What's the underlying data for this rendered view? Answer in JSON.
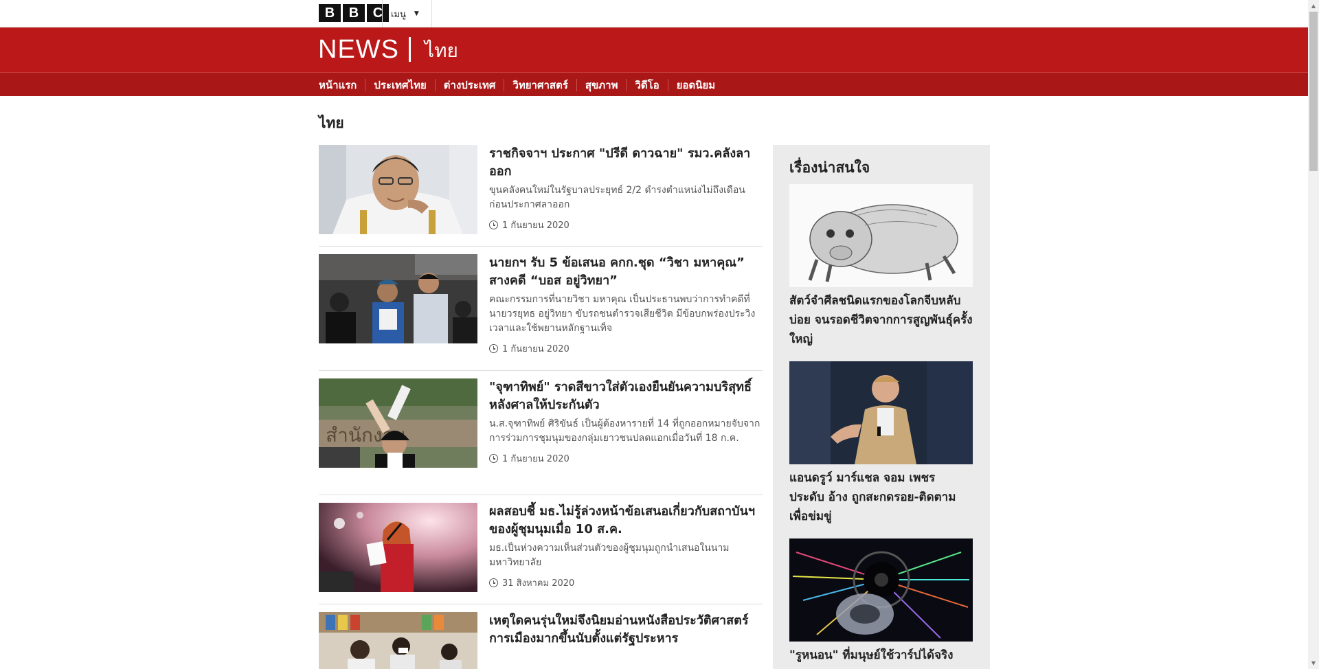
{
  "header": {
    "bbc_letters": [
      "B",
      "B",
      "C"
    ],
    "menu_label": "เมนู",
    "news_word": "NEWS",
    "language": "ไทย"
  },
  "nav": {
    "items": [
      {
        "label": "หน้าแรก"
      },
      {
        "label": "ประเทศไทย"
      },
      {
        "label": "ต่างประเทศ"
      },
      {
        "label": "วิทยาศาสตร์"
      },
      {
        "label": "สุขภาพ"
      },
      {
        "label": "วิดีโอ"
      },
      {
        "label": "ยอดนิยม"
      }
    ]
  },
  "page": {
    "title": "ไทย"
  },
  "stories": [
    {
      "headline": "ราชกิจจาฯ ประกาศ \"ปรีดี ดาวฉาย\" รมว.คลังลาออก",
      "summary": "ขุนคลังคนใหม่ในรัฐบาลประยุทธ์ 2/2 ดำรงตำแหน่งไม่ถึงเดือน ก่อนประกาศลาออก",
      "date": "1 กันยายน 2020",
      "image": "minister-portrait"
    },
    {
      "headline": "นายกฯ รับ 5 ข้อเสนอ คกก.ชุด “วิชา มหาคุณ” สางคดี “บอส อยู่วิทยา”",
      "summary": "คณะกรรมการที่นายวิชา มหาคุณ เป็นประธานพบว่าการทำคดีที่นายวรยุทธ อยู่วิทยา ขับรถชนตำรวจเสียชีวิต มีข้อบกพร่องประวิงเวลาและใช้พยานหลักฐานเท็จ",
      "date": "1 กันยายน 2020",
      "image": "press-crowd"
    },
    {
      "headline": "\"จุฑาทิพย์\" ราดสีขาวใส่ตัวเองยืนยันความบริสุทธิ์ หลังศาลให้ประกันตัว",
      "summary": "น.ส.จุฑาทิพย์ ศิริขันธ์ เป็นผู้ต้องหารายที่ 14 ที่ถูกออกหมายจับจากการร่วมการชุมนุมของกลุ่มเยาวชนปลดแอกเมื่อวันที่ 18 ก.ค.",
      "date": "1 กันยายน 2020",
      "image": "protest-white-paint"
    },
    {
      "headline": "ผลสอบชี้ มธ.ไม่รู้ล่วงหน้าข้อเสนอเกี่ยวกับสถาบันฯ ของผู้ชุมนุมเมื่อ 10 ส.ค.",
      "summary": "มธ.เป็นห่วงความเห็นส่วนตัวของผู้ชุมนุมถูกนำเสนอในนามมหาวิทยาลัย",
      "date": "31 สิงหาคม 2020",
      "image": "speaker-on-stage"
    },
    {
      "headline": "เหตุใดคนรุ่นใหม่จึงนิยมอ่านหนังสือประวัติศาสตร์การเมืองมากขึ้นนับตั้งแต่รัฐประหาร",
      "summary": "",
      "date": "",
      "image": "bookstore-readers"
    }
  ],
  "sidebar": {
    "title": "เรื่องน่าสนใจ",
    "items": [
      {
        "headline": "สัตว์จำศีลชนิดแรกของโลกจีบหลับบ่อย จนรอดชีวิตจากการสูญพันธุ์ครั้งใหญ่",
        "image": "ancient-creature-drawing"
      },
      {
        "headline": "แอนดรูว์ มาร์แชล จอม เพชร ประดับ อ้าง ถูกสะกดรอย-ติดตามเพื่อข่มขู่",
        "image": "man-speaking"
      },
      {
        "headline": "\"รูหนอน\" ที่มนุษย์ใช้วาร์ปได้จริง",
        "image": "wormhole-illustration"
      }
    ]
  },
  "colors": {
    "brand_red": "#bb1919",
    "nav_red": "#a91717",
    "sidebar_bg": "#ebebeb"
  }
}
